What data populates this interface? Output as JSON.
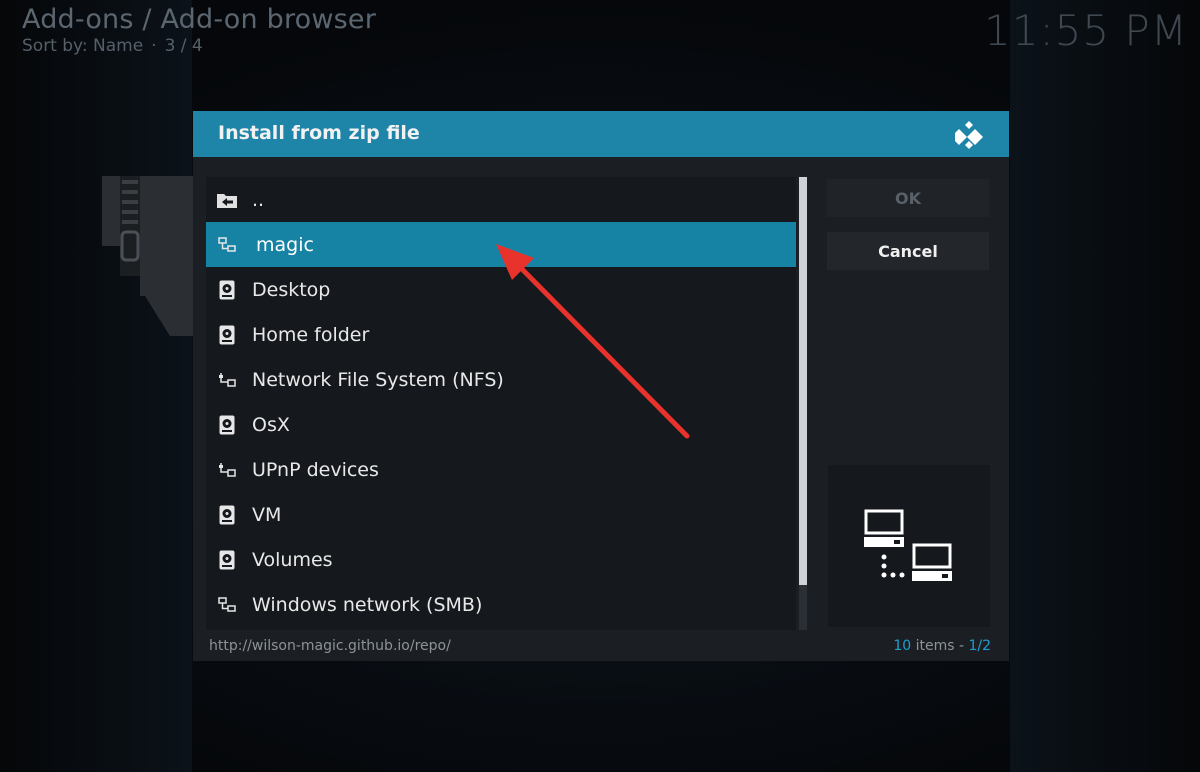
{
  "header": {
    "breadcrumb": "Add-ons / Add-on browser",
    "sort_label": "Sort by: Name",
    "separator": "·",
    "page": "3 / 4"
  },
  "clock": "11:55 PM",
  "dialog": {
    "title": "Install from zip file",
    "logo_icon": "kodi-logo-icon",
    "accent_color": "#1e85a8",
    "items": [
      {
        "label": "..",
        "icon": "folder-back-icon"
      },
      {
        "label": "magic",
        "icon": "network-share-icon",
        "selected": true
      },
      {
        "label": "Desktop",
        "icon": "hard-drive-icon"
      },
      {
        "label": "Home folder",
        "icon": "hard-drive-icon"
      },
      {
        "label": "Network File System (NFS)",
        "icon": "network-icon"
      },
      {
        "label": "OsX",
        "icon": "hard-drive-icon"
      },
      {
        "label": "UPnP devices",
        "icon": "network-icon"
      },
      {
        "label": "VM",
        "icon": "hard-drive-icon"
      },
      {
        "label": "Volumes",
        "icon": "hard-drive-icon"
      },
      {
        "label": "Windows network (SMB)",
        "icon": "network-share-icon"
      }
    ],
    "ok_label": "OK",
    "cancel_label": "Cancel",
    "preview_icon": "network-computers-icon",
    "path": "http://wilson-magic.github.io/repo/",
    "count_number": "10",
    "count_text": " items - ",
    "count_page": "1/2"
  }
}
